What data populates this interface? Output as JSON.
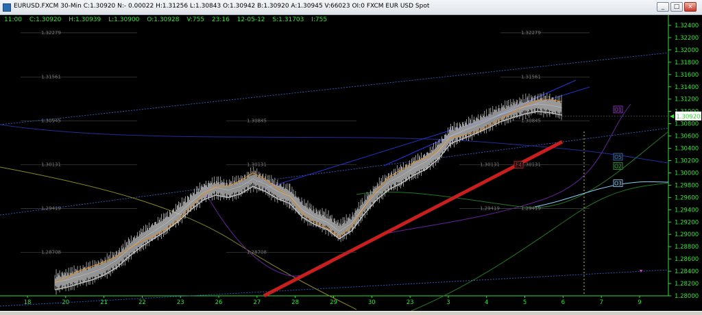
{
  "window": {
    "title": "EURUSD.FXCM 30-Min  C:1.30920 N:- 0.00022 H:1.31256 L:1.30843 O:1.30942 B:1.30920 A:1.30945 V:66023 OI:0 FXCM EUR USD Spot",
    "min_label": "_",
    "max_label": "□",
    "close_label": "×"
  },
  "info": {
    "time": "11:00",
    "close": "C:1.30920",
    "high": "H:1.30939",
    "low": "L:1.30900",
    "open": "O:1.30928",
    "volume": "V:755",
    "time2": "23:16",
    "date": "12-05-12",
    "s": "S:1.31703",
    "i": "I:755"
  },
  "colors": {
    "background": "#000000",
    "axis_text": "#2ee52e",
    "price_bars": "#c0c0c0",
    "red_trend": "#c81e1e",
    "blue_channel": "#2233cc",
    "dotted_channel": "#3355bb",
    "olive_ma": "#8a8a20",
    "orange_ma": "#e08a1e",
    "purple_line": "#6a1fa0",
    "green_line": "#1f7a1f",
    "grey_ma": "#bdbdbd",
    "last_price_box": "#ffffff",
    "last_price_text": "#b000b0"
  },
  "chart_data": {
    "type": "line",
    "symbol": "EURUSD.FXCM",
    "interval": "30-Min",
    "ylim": [
      1.28,
      1.325
    ],
    "y_ticks": [
      "1.32400",
      "1.32200",
      "1.32000",
      "1.31800",
      "1.31600",
      "1.31400",
      "1.31200",
      "1.31000",
      "1.30800",
      "1.30600",
      "1.30400",
      "1.30200",
      "1.30000",
      "1.29800",
      "1.29600",
      "1.29400",
      "1.29200",
      "1.29000",
      "1.28800",
      "1.28600",
      "1.28400",
      "1.28200",
      "1.28000"
    ],
    "x_ticks": [
      "18",
      "20",
      "21",
      "22",
      "23",
      "26",
      "27",
      "28",
      "29",
      "30",
      "23",
      "3",
      "4",
      "5",
      "6",
      "7",
      "9"
    ],
    "last_price": "1.30920",
    "level_labels": [
      {
        "text": "1.32279",
        "price": 1.32279,
        "side": "left"
      },
      {
        "text": "1.32279",
        "price": 1.32279,
        "side": "right"
      },
      {
        "text": "1.31561",
        "price": 1.31561,
        "side": "left"
      },
      {
        "text": "1.31561",
        "price": 1.31561,
        "side": "right"
      },
      {
        "text": "1.30945",
        "price": 1.30845,
        "side": "left"
      },
      {
        "text": "1.30845",
        "price": 1.30845,
        "side": "mid"
      },
      {
        "text": "1.30845",
        "price": 1.30845,
        "side": "right"
      },
      {
        "text": "1.30131",
        "price": 1.30131,
        "side": "left"
      },
      {
        "text": "1.30131",
        "price": 1.30131,
        "side": "mid"
      },
      {
        "text": "1.30131",
        "price": 1.30131,
        "side": "right2"
      },
      {
        "text": "1.30131",
        "price": 1.30131,
        "side": "right"
      },
      {
        "text": "1.29419",
        "price": 1.29419,
        "side": "left"
      },
      {
        "text": "1.29419",
        "price": 1.29419,
        "side": "right2"
      },
      {
        "text": "1.29419",
        "price": 1.29419,
        "side": "right"
      },
      {
        "text": "1.28708",
        "price": 1.28708,
        "side": "left"
      },
      {
        "text": "1.28708",
        "price": 1.28708,
        "side": "mid"
      }
    ],
    "badges": [
      {
        "text": "O1",
        "color": "#9a2fd6",
        "price": 1.3102
      },
      {
        "text": "O5",
        "color": "#2f7fd6",
        "price": 1.3025
      },
      {
        "text": "O2",
        "color": "#2faa3a",
        "price": 1.301
      },
      {
        "text": "O3",
        "color": "#8ad0ff",
        "price": 1.2982
      },
      {
        "text": "F4",
        "color": "#e02020",
        "price": 1.3012
      }
    ],
    "series": [
      {
        "values": [
          1.2822,
          1.2826,
          1.2832,
          1.2838,
          1.2846,
          1.2858,
          1.2876,
          1.2892,
          1.2905,
          1.2918,
          1.2934,
          1.2952,
          1.2968,
          1.2976,
          1.2972,
          1.2978,
          1.299,
          1.2982,
          1.297,
          1.2962,
          1.294,
          1.2928,
          1.292,
          1.2905,
          1.2918,
          1.2945,
          1.2968,
          1.2985,
          1.2995,
          1.3008,
          1.3018,
          1.3035,
          1.306,
          1.3068,
          1.3076,
          1.3085,
          1.3095,
          1.3102,
          1.3108,
          1.3112,
          1.311,
          1.3106
        ]
      }
    ],
    "x": [
      0,
      1,
      2,
      3,
      4,
      5,
      6,
      7,
      8,
      9,
      10,
      11,
      12,
      13,
      14,
      15,
      16,
      17,
      18,
      19,
      20,
      21,
      22,
      23,
      24,
      25,
      26,
      27,
      28,
      29,
      30,
      31,
      32,
      33,
      34,
      35,
      36,
      37,
      38,
      39,
      40,
      41
    ]
  }
}
